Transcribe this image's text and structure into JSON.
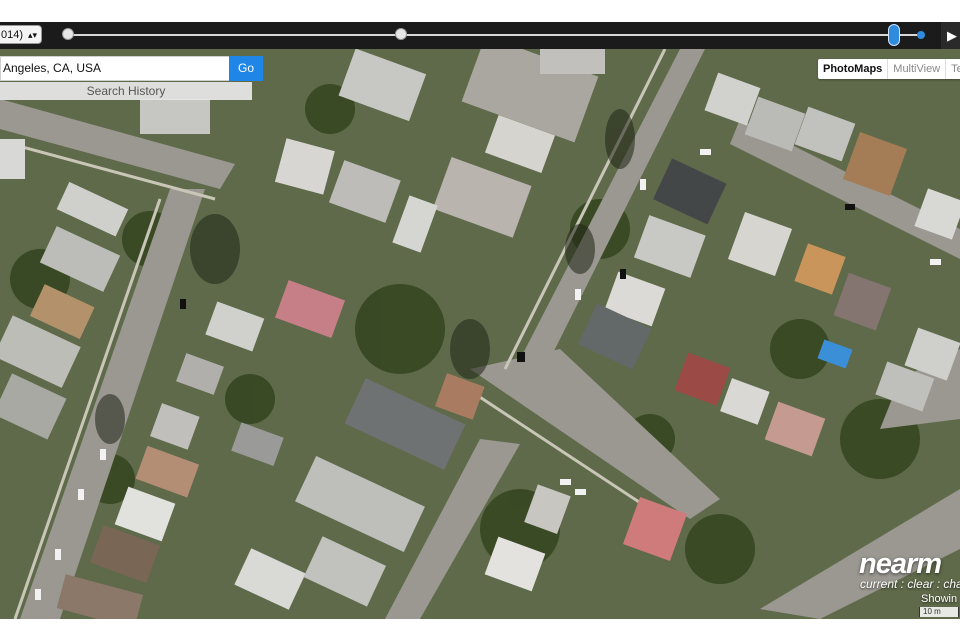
{
  "toolbar": {
    "date_select_value": "014)",
    "play_icon": "▶",
    "slider_position_fraction": 0.96
  },
  "search": {
    "value": "Angeles, CA, USA",
    "go_label": "Go",
    "history_label": "Search History"
  },
  "map_tabs": [
    "PhotoMaps",
    "MultiView",
    "Terr"
  ],
  "brand": {
    "logo": "nearm",
    "tagline": "current : clear : char",
    "showing": "Showin",
    "scale": "10 m"
  },
  "colors": {
    "accent": "#1f86e8",
    "toolbar": "#1b1b1b"
  }
}
